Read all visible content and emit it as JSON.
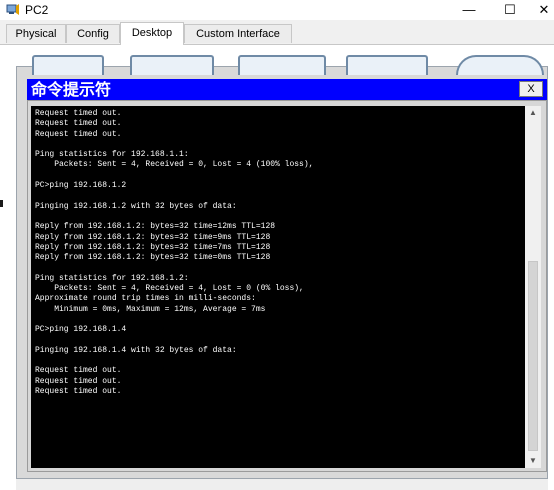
{
  "window": {
    "title": "PC2",
    "minimize_glyph": "—",
    "maximize_glyph": "☐",
    "close_glyph": "✕"
  },
  "tabs": [
    {
      "label": "Physical"
    },
    {
      "label": "Config"
    },
    {
      "label": "Desktop"
    },
    {
      "label": "Custom Interface"
    }
  ],
  "command_prompt": {
    "title": "命令提示符",
    "close_label": "X",
    "lines": [
      "Request timed out.",
      "Request timed out.",
      "Request timed out.",
      "",
      "Ping statistics for 192.168.1.1:",
      "    Packets: Sent = 4, Received = 0, Lost = 4 (100% loss),",
      "",
      "PC>ping 192.168.1.2",
      "",
      "Pinging 192.168.1.2 with 32 bytes of data:",
      "",
      "Reply from 192.168.1.2: bytes=32 time=12ms TTL=128",
      "Reply from 192.168.1.2: bytes=32 time=9ms TTL=128",
      "Reply from 192.168.1.2: bytes=32 time=7ms TTL=128",
      "Reply from 192.168.1.2: bytes=32 time=0ms TTL=128",
      "",
      "Ping statistics for 192.168.1.2:",
      "    Packets: Sent = 4, Received = 4, Lost = 0 (0% loss),",
      "Approximate round trip times in milli-seconds:",
      "    Minimum = 0ms, Maximum = 12ms, Average = 7ms",
      "",
      "PC>ping 192.168.1.4",
      "",
      "Pinging 192.168.1.4 with 32 bytes of data:",
      "",
      "Request timed out.",
      "Request timed out.",
      "Request timed out.",
      ""
    ]
  },
  "icons": {
    "app": "router-pc-icon",
    "scroll_up": "chevron-up-icon",
    "scroll_down": "chevron-down-icon"
  },
  "colors": {
    "prompt_header": "#0000ff",
    "terminal_bg": "#000000",
    "terminal_text": "#ffffff"
  }
}
